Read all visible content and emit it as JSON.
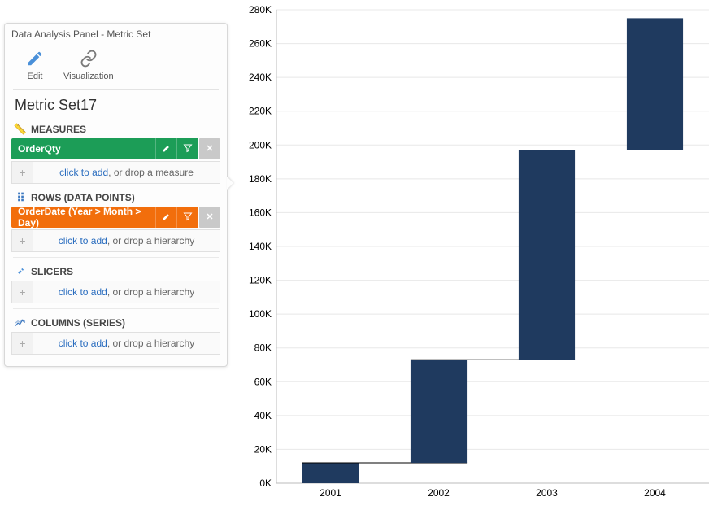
{
  "panel": {
    "title": "Data Analysis Panel - Metric Set",
    "toolbar": {
      "edit": "Edit",
      "visualization": "Visualization"
    },
    "metric_name": "Metric Set17",
    "measures": {
      "header": "MEASURES",
      "chip": "OrderQty",
      "drop_link": "click to add",
      "drop_suffix": ", or drop a measure"
    },
    "rows": {
      "header": "ROWS (DATA POINTS)",
      "chip": "OrderDate (Year > Month > Day)",
      "drop_link": "click to add",
      "drop_suffix": ", or drop a hierarchy"
    },
    "slicers": {
      "header": "SLICERS",
      "drop_link": "click to add",
      "drop_suffix": ", or drop a hierarchy"
    },
    "columns": {
      "header": "COLUMNS (SERIES)",
      "drop_link": "click to add",
      "drop_suffix": ", or drop a hierarchy"
    }
  },
  "chart_data": {
    "type": "bar",
    "subtype": "waterfall",
    "categories": [
      "2001",
      "2002",
      "2003",
      "2004"
    ],
    "bars": [
      {
        "category": "2001",
        "start": 0,
        "end": 12000
      },
      {
        "category": "2002",
        "start": 12000,
        "end": 73000
      },
      {
        "category": "2003",
        "start": 73000,
        "end": 197000
      },
      {
        "category": "2004",
        "start": 197000,
        "end": 275000
      }
    ],
    "ylim": [
      0,
      280000
    ],
    "yticks": [
      0,
      20000,
      40000,
      60000,
      80000,
      100000,
      120000,
      140000,
      160000,
      180000,
      200000,
      220000,
      240000,
      260000,
      280000
    ],
    "ytick_labels": [
      "0K",
      "20K",
      "40K",
      "60K",
      "80K",
      "100K",
      "120K",
      "140K",
      "160K",
      "180K",
      "200K",
      "220K",
      "240K",
      "260K",
      "280K"
    ],
    "bar_color": "#1f3a5f"
  }
}
